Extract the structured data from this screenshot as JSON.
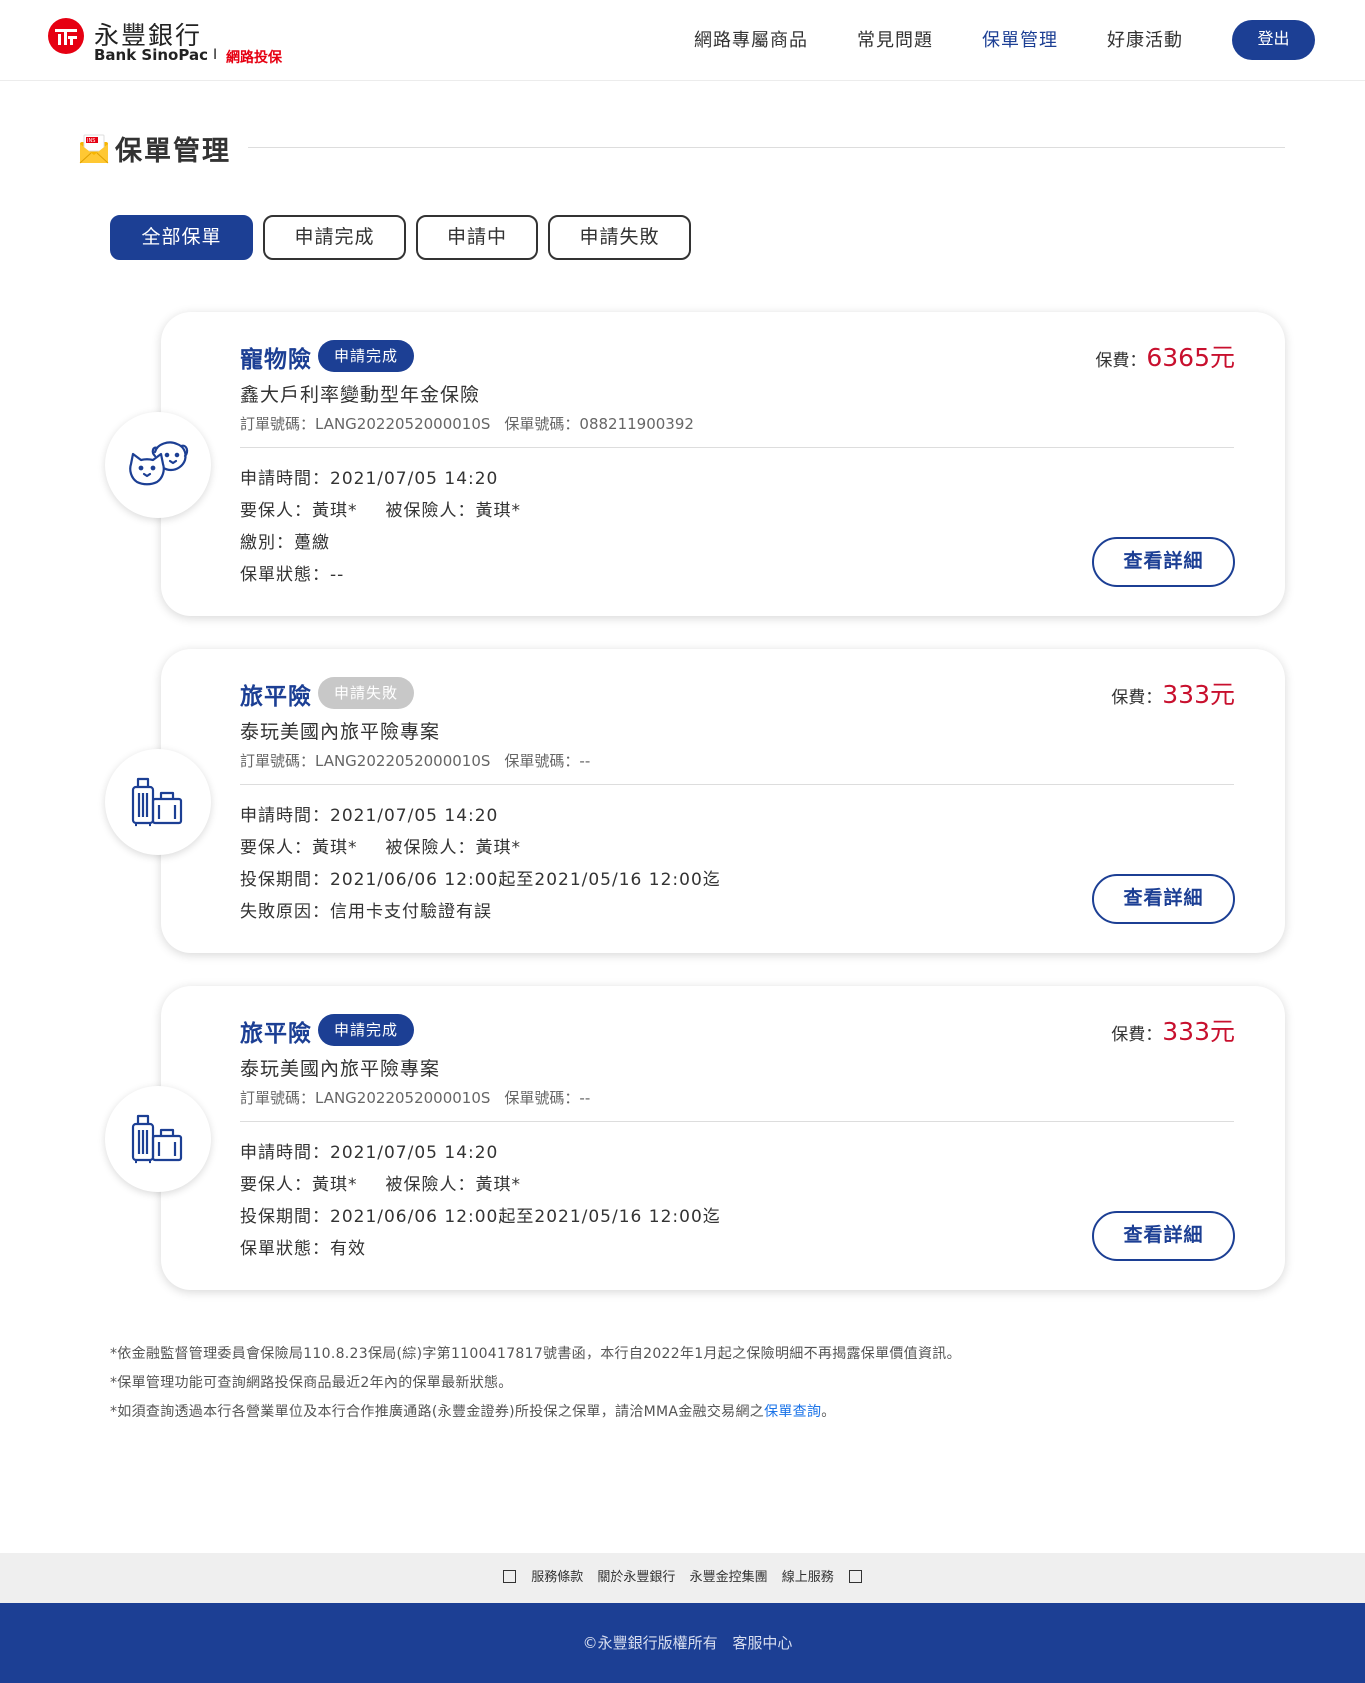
{
  "brand": {
    "name_cn": "永豐銀行",
    "name_en": "Bank SinoPac",
    "separator": "I",
    "subtitle": "網路投保",
    "accent_color": "#1c3f94",
    "brand_red": "#e60012"
  },
  "nav": {
    "items": [
      {
        "label": "網路專屬商品"
      },
      {
        "label": "常見問題"
      },
      {
        "label": "保單管理"
      },
      {
        "label": "好康活動"
      }
    ],
    "active": "保單管理",
    "logout_label": "登出"
  },
  "page": {
    "title": "保單管理",
    "icon": "envelope-ins-icon"
  },
  "tabs": [
    {
      "label": "全部保單",
      "active": true
    },
    {
      "label": "申請完成",
      "active": false
    },
    {
      "label": "申請中",
      "active": false
    },
    {
      "label": "申請失敗",
      "active": false
    }
  ],
  "policies": [
    {
      "icon": "pet-icon",
      "type": "寵物險",
      "status": "申請完成",
      "premium_label": "保費：",
      "premium": "6365元",
      "product": "鑫大戶利率變動型年金保險",
      "order_no": "訂單號碼：LANG2022052000010S",
      "policy_no": "保單號碼：088211900392",
      "rows": [
        "申請時間：2021/07/05 14:20",
        "要保人：黃琪*",
        "繳別：躉繳",
        "保單狀態：--"
      ],
      "insured": "被保險人：黃琪*",
      "detail_label": "查看詳細"
    },
    {
      "icon": "luggage-icon",
      "type": "旅平險",
      "status": "申請失敗",
      "premium_label": "保費：",
      "premium": "333元",
      "product": "泰玩美國內旅平險專案",
      "order_no": "訂單號碼：LANG2022052000010S",
      "policy_no": "保單號碼：--",
      "rows": [
        "申請時間：2021/07/05 14:20",
        "要保人：黃琪*",
        "投保期間：2021/06/06 12:00起至2021/05/16 12:00迄",
        "失敗原因：信用卡支付驗證有誤"
      ],
      "insured": "被保險人：黃琪*",
      "detail_label": "查看詳細"
    },
    {
      "icon": "luggage-icon",
      "type": "旅平險",
      "status": "申請完成",
      "premium_label": "保費：",
      "premium": "333元",
      "product": "泰玩美國內旅平險專案",
      "order_no": "訂單號碼：LANG2022052000010S",
      "policy_no": "保單號碼：--",
      "rows": [
        "申請時間：2021/07/05 14:20",
        "要保人：黃琪*",
        "投保期間：2021/06/06 12:00起至2021/05/16 12:00迄",
        "保單狀態：有效"
      ],
      "insured": "被保險人：黃琪*",
      "detail_label": "查看詳細"
    }
  ],
  "notes": [
    "*依金融監督管理委員會保險局110.8.23保局(綜)字第1100417817號書函，本行自2022年1月起之保險明細不再揭露保單價值資訊。",
    "*保單管理功能可查詢網路投保商品最近2年內的保單最新狀態。",
    "*如須查詢透過本行各營業單位及本行合作推廣通路(永豐金證券)所投保之保單，請洽MMA金融交易網之"
  ],
  "note_link": "保單查詢",
  "note_end": "。",
  "footer": {
    "links": [
      "服務條款",
      "關於永豐銀行",
      "永豐金控集團",
      "線上服務"
    ],
    "copyright": "©永豐銀行版權所有",
    "service": "客服中心"
  }
}
